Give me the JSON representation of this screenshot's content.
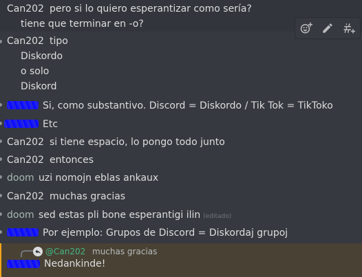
{
  "messages": [
    {
      "author": "Can202",
      "lines": [
        "pero si lo quiero esperantizar como sería?",
        "tiene que terminar en -o?"
      ]
    },
    {
      "author": "Can202",
      "lines": [
        "tipo",
        "Diskordo",
        "o solo",
        "Diskord"
      ]
    },
    {
      "author": "",
      "text": "Si, como substantivo. Discord = Diskordo / Tik Tok = TikToko"
    },
    {
      "author": "",
      "text": "Etc"
    },
    {
      "author": "Can202",
      "text": "si tiene espacio, lo pongo todo junto"
    },
    {
      "author": "Can202",
      "text": "entonces"
    },
    {
      "author": "doom",
      "text": "uzi nomojn eblas ankaux"
    },
    {
      "author": "Can202",
      "text": "muchas gracias"
    },
    {
      "author": "doom",
      "text": "sed estas pli bone esperantigi ilin",
      "edited": "(editado)"
    },
    {
      "author": "",
      "text": "Por ejemplo: Grupos de Discord = Diskordaj grupoj"
    }
  ],
  "reply": {
    "mention": "@Can202",
    "quoted": "muchas gracias",
    "text": "Nedankinde!"
  },
  "toolbar": {
    "icons": [
      "add-reaction-icon",
      "edit-icon",
      "thread-icon"
    ]
  },
  "colors": {
    "background": "#36393f",
    "author_green": "#43b581",
    "mention_highlight": "#494234",
    "mention_bar": "#faa61a"
  }
}
